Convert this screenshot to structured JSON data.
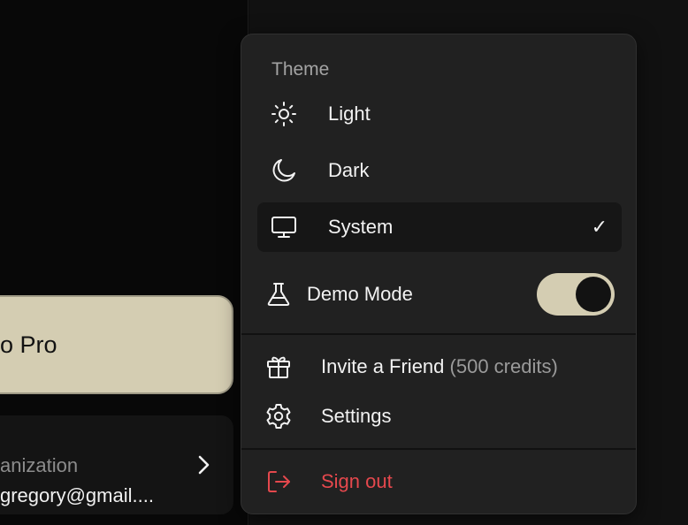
{
  "background": {
    "upgrade_button_label": "o Pro",
    "org_card": {
      "label": "anization",
      "email": "gregory@gmail...."
    }
  },
  "menu": {
    "theme_section_label": "Theme",
    "theme_options": [
      {
        "label": "Light",
        "icon": "sun-icon",
        "selected": false
      },
      {
        "label": "Dark",
        "icon": "moon-icon",
        "selected": false
      },
      {
        "label": "System",
        "icon": "monitor-icon",
        "selected": true
      }
    ],
    "selected_check": "✓",
    "demo_mode": {
      "label": "Demo Mode",
      "icon": "flask-icon",
      "enabled": true
    },
    "invite": {
      "label": "Invite a Friend",
      "credits": "(500 credits)",
      "icon": "gift-icon"
    },
    "settings": {
      "label": "Settings",
      "icon": "gear-icon"
    },
    "sign_out": {
      "label": "Sign out",
      "icon": "sign-out-icon"
    }
  },
  "colors": {
    "menu_bg": "#212121",
    "accent": "#d4cdb2",
    "danger": "#e5484d",
    "muted_text": "#a3a3a3"
  }
}
